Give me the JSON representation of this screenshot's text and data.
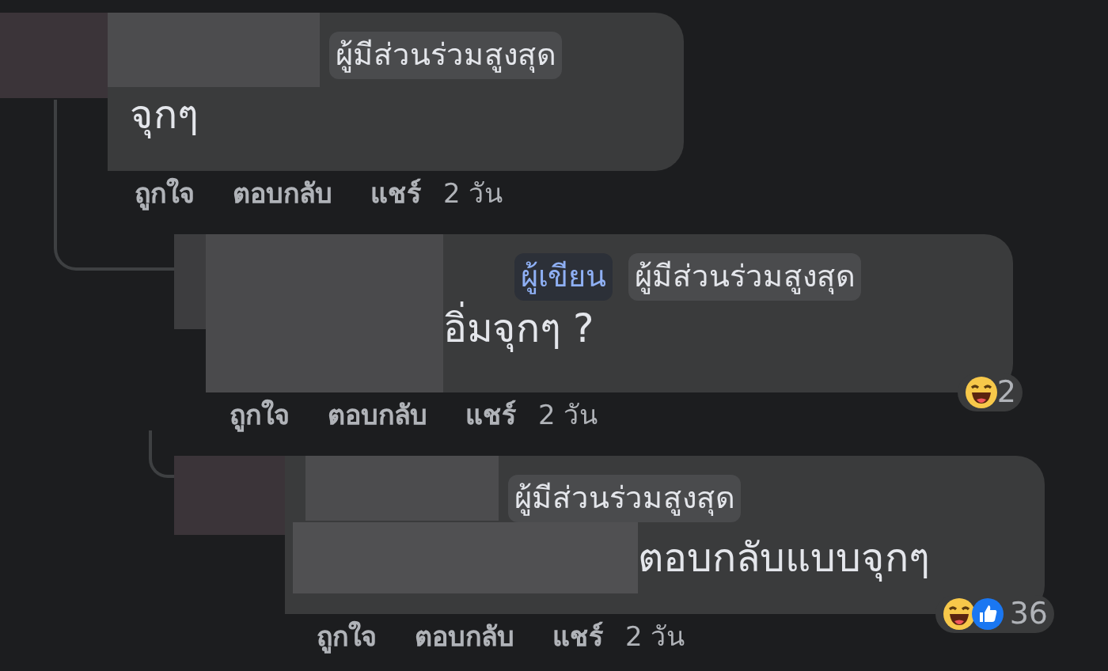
{
  "comments": [
    {
      "badges": [
        {
          "kind": "top_fan",
          "label": "ผู้มีส่วนร่วมสูงสุด"
        }
      ],
      "text": "จุกๆ",
      "actions": [
        "ถูกใจ",
        "ตอบกลับ",
        "แชร์"
      ],
      "time": "2 วัน",
      "children": [
        {
          "badges": [
            {
              "kind": "author",
              "label": "ผู้เขียน"
            },
            {
              "kind": "top_fan",
              "label": "ผู้มีส่วนร่วมสูงสุด"
            }
          ],
          "text": "อิ่มจุกๆ ?",
          "actions": [
            "ถูกใจ",
            "ตอบกลับ",
            "แชร์"
          ],
          "time": "2 วัน",
          "reactions": [
            {
              "kind": "haha"
            }
          ],
          "reaction_count": "2",
          "children": [
            {
              "badges": [
                {
                  "kind": "top_fan",
                  "label": "ผู้มีส่วนร่วมสูงสุด"
                }
              ],
              "text": "ตอบกลับแบบจุกๆ",
              "actions": [
                "ถูกใจ",
                "ตอบกลับ",
                "แชร์"
              ],
              "time": "2 วัน",
              "reactions": [
                {
                  "kind": "haha"
                },
                {
                  "kind": "like"
                }
              ],
              "reaction_count": "36"
            }
          ]
        }
      ]
    }
  ]
}
